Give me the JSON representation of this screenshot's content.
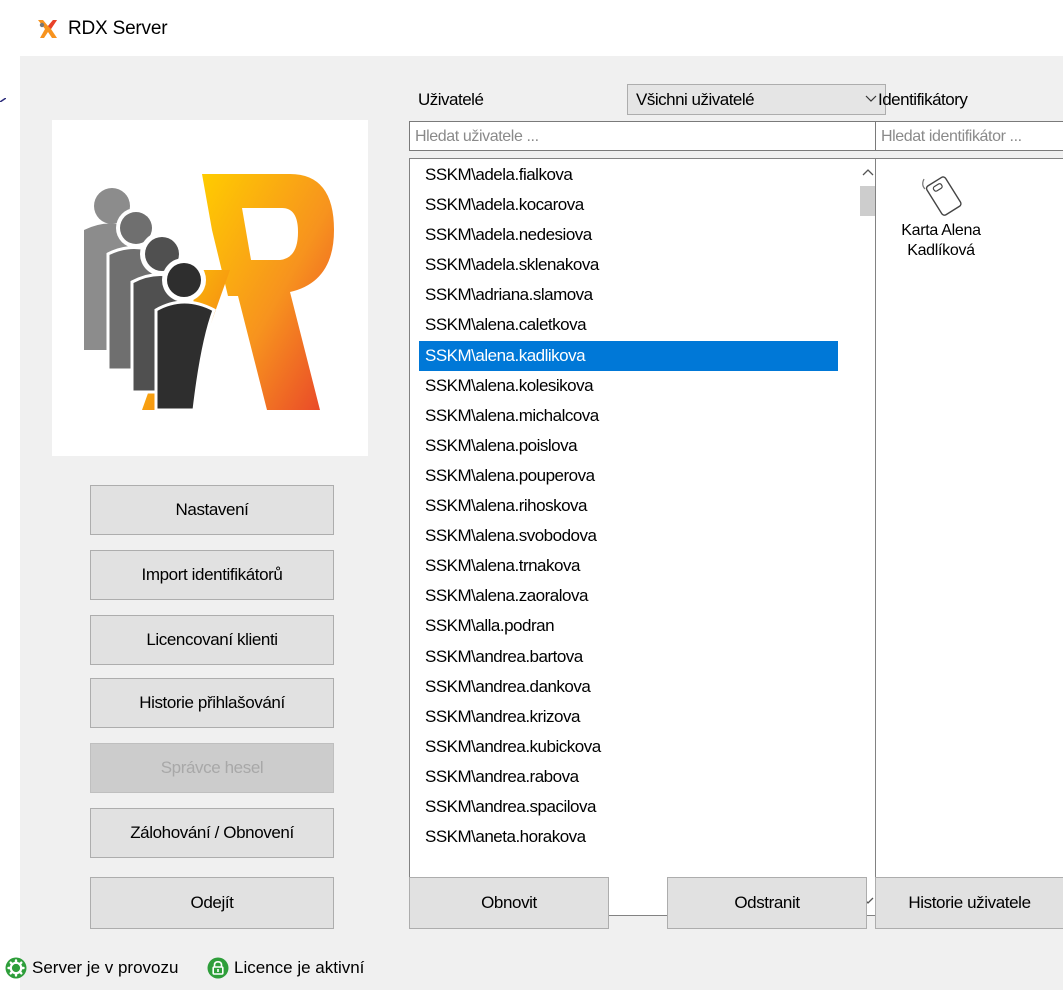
{
  "window": {
    "title": "RDX Server",
    "icon": "rdx-app-icon"
  },
  "sidebar": {
    "buttons": [
      {
        "label": "Nastavení",
        "enabled": true
      },
      {
        "label": "Import identifikátorů",
        "enabled": true
      },
      {
        "label": "Licencovaní klienti",
        "enabled": true
      },
      {
        "label": "Historie přihlašování",
        "enabled": true
      },
      {
        "label": "Správce hesel",
        "enabled": false
      },
      {
        "label": "Zálohování / Obnovení",
        "enabled": true
      }
    ],
    "exit_label": "Odejít"
  },
  "users": {
    "label": "Uživatelé",
    "filter_value": "Všichni uživatelé",
    "search_placeholder": "Hledat uživatele ...",
    "selected_index": 6,
    "items": [
      "SSKM\\adela.fialkova",
      "SSKM\\adela.kocarova",
      "SSKM\\adela.nedesiova",
      "SSKM\\adela.sklenakova",
      "SSKM\\adriana.slamova",
      "SSKM\\alena.caletkova",
      "SSKM\\alena.kadlikova",
      "SSKM\\alena.kolesikova",
      "SSKM\\alena.michalcova",
      "SSKM\\alena.poislova",
      "SSKM\\alena.pouperova",
      "SSKM\\alena.rihoskova",
      "SSKM\\alena.svobodova",
      "SSKM\\alena.trnakova",
      "SSKM\\alena.zaoralova",
      "SSKM\\alla.podran",
      "SSKM\\andrea.bartova",
      "SSKM\\andrea.dankova",
      "SSKM\\andrea.krizova",
      "SSKM\\andrea.kubickova",
      "SSKM\\andrea.rabova",
      "SSKM\\andrea.spacilova",
      "SSKM\\aneta.horakova"
    ],
    "refresh_label": "Obnovit",
    "remove_label": "Odstranit"
  },
  "identifiers": {
    "label": "Identifikátory",
    "search_placeholder": "Hledat identifikátor ...",
    "items": [
      {
        "name_line1": "Karta Alena",
        "name_line2": "Kadlíková",
        "icon": "rfid-card-icon"
      }
    ],
    "history_label": "Historie uživatele"
  },
  "status": {
    "server": "Server je v provozu",
    "licence": "Licence je aktivní",
    "ok_color": "#2e9e3a"
  },
  "colors": {
    "selection": "#0078d7",
    "logo_orange": "#f7931e",
    "logo_red": "#e8412a"
  }
}
